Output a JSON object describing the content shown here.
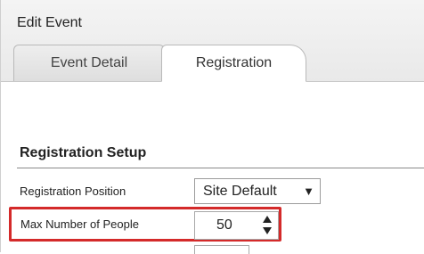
{
  "window": {
    "title": "Edit Event"
  },
  "tabs": [
    {
      "label": "Event Detail",
      "active": false
    },
    {
      "label": "Registration",
      "active": true
    }
  ],
  "section": {
    "title": "Registration Setup"
  },
  "fields": {
    "registration_position": {
      "label": "Registration Position",
      "value": "Site Default"
    },
    "max_people": {
      "label": "Max Number of People",
      "value": "50"
    }
  },
  "colors": {
    "highlight": "#d42a2a"
  },
  "icons": {
    "dropdown": "caret-down-icon",
    "increment": "arrow-up-icon",
    "decrement": "arrow-down-icon"
  }
}
